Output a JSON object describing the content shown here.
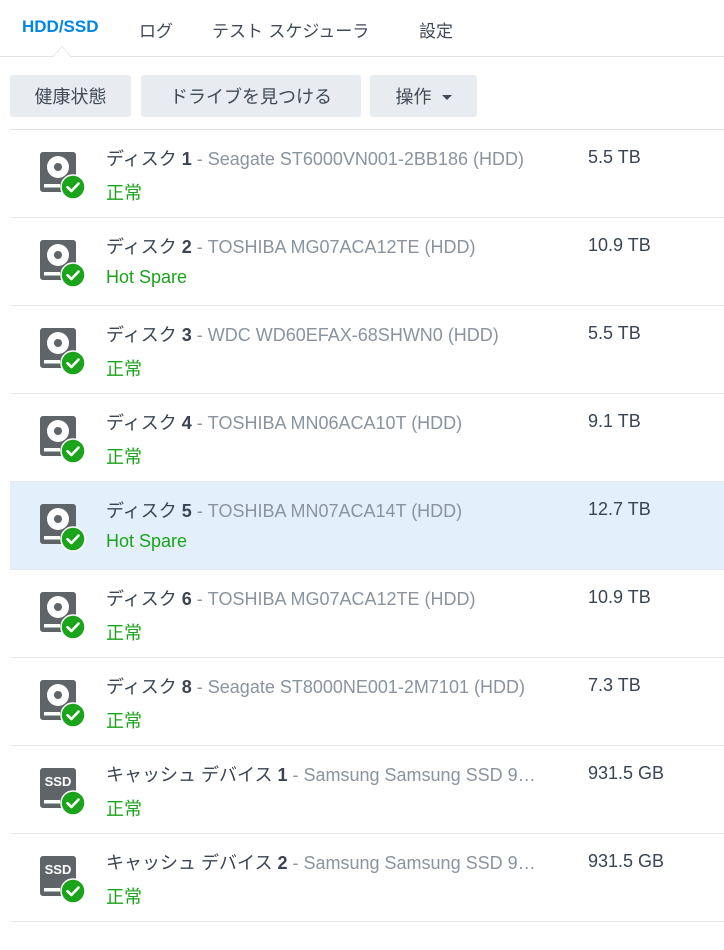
{
  "tabs": [
    {
      "label": "HDD/SSD",
      "active": true
    },
    {
      "label": "ログ",
      "active": false
    },
    {
      "label": "テスト スケジューラ",
      "active": false
    },
    {
      "label": "設定",
      "active": false
    }
  ],
  "toolbar": {
    "health_label": "健康状態",
    "locate_label": "ドライブを見つける",
    "action_label": "操作"
  },
  "colors": {
    "accent": "#0086e5",
    "status_ok": "#1ba31b",
    "selected_row": "#e3f0fc",
    "drive_icon": "#5f6468"
  },
  "drives": [
    {
      "label": "ディスク",
      "num": "1",
      "model": " - Seagate ST6000VN001-2BB186 (HDD)",
      "status": "正常",
      "size": "5.5 TB",
      "type": "hdd",
      "selected": false
    },
    {
      "label": "ディスク",
      "num": "2",
      "model": " - TOSHIBA MG07ACA12TE (HDD)",
      "status": "Hot Spare",
      "size": "10.9 TB",
      "type": "hdd",
      "selected": false
    },
    {
      "label": "ディスク",
      "num": "3",
      "model": " - WDC WD60EFAX-68SHWN0 (HDD)",
      "status": "正常",
      "size": "5.5 TB",
      "type": "hdd",
      "selected": false
    },
    {
      "label": "ディスク",
      "num": "4",
      "model": " - TOSHIBA MN06ACA10T (HDD)",
      "status": "正常",
      "size": "9.1 TB",
      "type": "hdd",
      "selected": false
    },
    {
      "label": "ディスク",
      "num": "5",
      "model": " - TOSHIBA MN07ACA14T (HDD)",
      "status": "Hot Spare",
      "size": "12.7 TB",
      "type": "hdd",
      "selected": true
    },
    {
      "label": "ディスク",
      "num": "6",
      "model": " - TOSHIBA MG07ACA12TE (HDD)",
      "status": "正常",
      "size": "10.9 TB",
      "type": "hdd",
      "selected": false
    },
    {
      "label": "ディスク",
      "num": "8",
      "model": " - Seagate ST8000NE001-2M7101 (HDD)",
      "status": "正常",
      "size": "7.3 TB",
      "type": "hdd",
      "selected": false
    },
    {
      "label": "キャッシュ デバイス",
      "num": "1",
      "model": " - Samsung Samsung SSD 9…",
      "status": "正常",
      "size": "931.5 GB",
      "type": "ssd",
      "selected": false
    },
    {
      "label": "キャッシュ デバイス",
      "num": "2",
      "model": " - Samsung Samsung SSD 9…",
      "status": "正常",
      "size": "931.5 GB",
      "type": "ssd",
      "selected": false
    }
  ],
  "icons": {
    "hdd": "hdd-drive-icon",
    "ssd": "ssd-drive-icon",
    "ok_badge": "check-badge-icon",
    "ssd_text": "SSD"
  }
}
